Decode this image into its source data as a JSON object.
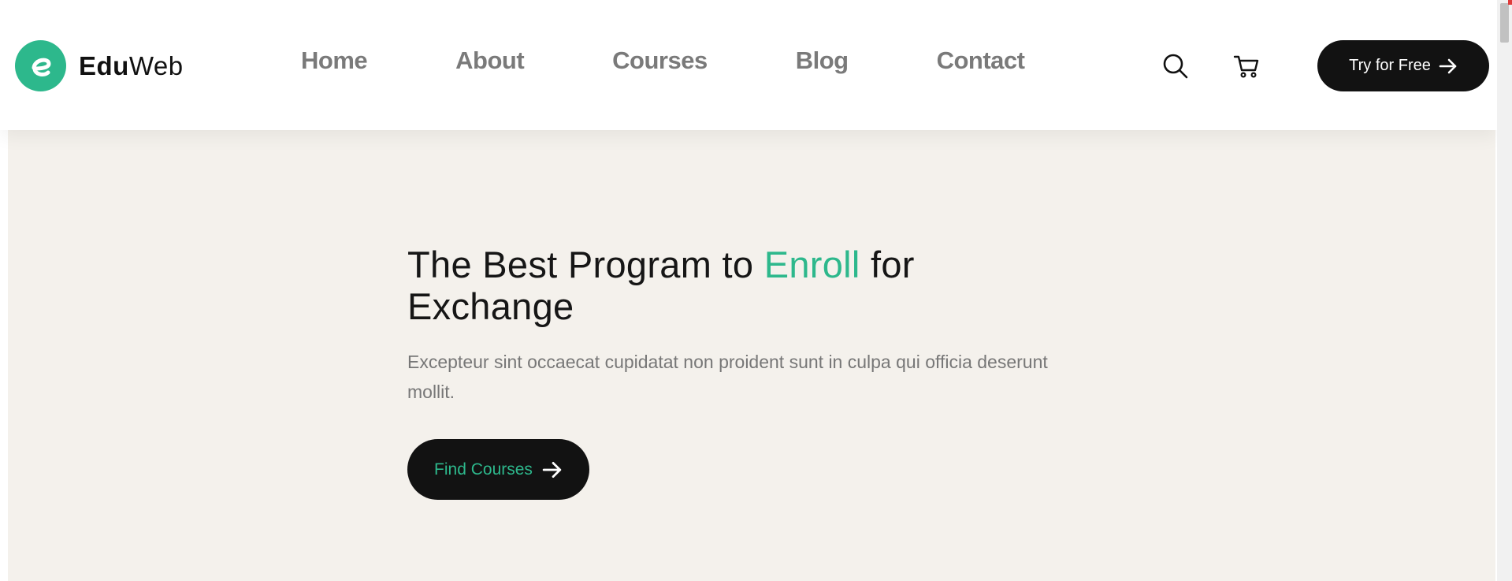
{
  "header": {
    "logo": {
      "bold": "Edu",
      "regular": "Web",
      "icon": "eduweb-logo-icon"
    },
    "nav": [
      {
        "label": "Home"
      },
      {
        "label": "About"
      },
      {
        "label": "Courses"
      },
      {
        "label": "Blog"
      },
      {
        "label": "Contact"
      }
    ],
    "icons": {
      "search": "search-icon",
      "cart": "cart-icon"
    },
    "cta": {
      "label": "Try for Free",
      "icon": "arrow-right-icon"
    }
  },
  "hero": {
    "title_before": "The Best Program to ",
    "title_accent": "Enroll",
    "title_after": " for Exchange",
    "description": "Excepteur sint occaecat cupidatat non proident sunt in culpa qui officia deserunt mollit.",
    "button": {
      "label": "Find Courses",
      "icon": "arrow-right-icon"
    }
  },
  "colors": {
    "accent": "#2db88c",
    "dark": "#121212",
    "nav_text": "#7a7a7a",
    "hero_bg": "#f4f1ec",
    "body_text": "#777777"
  }
}
